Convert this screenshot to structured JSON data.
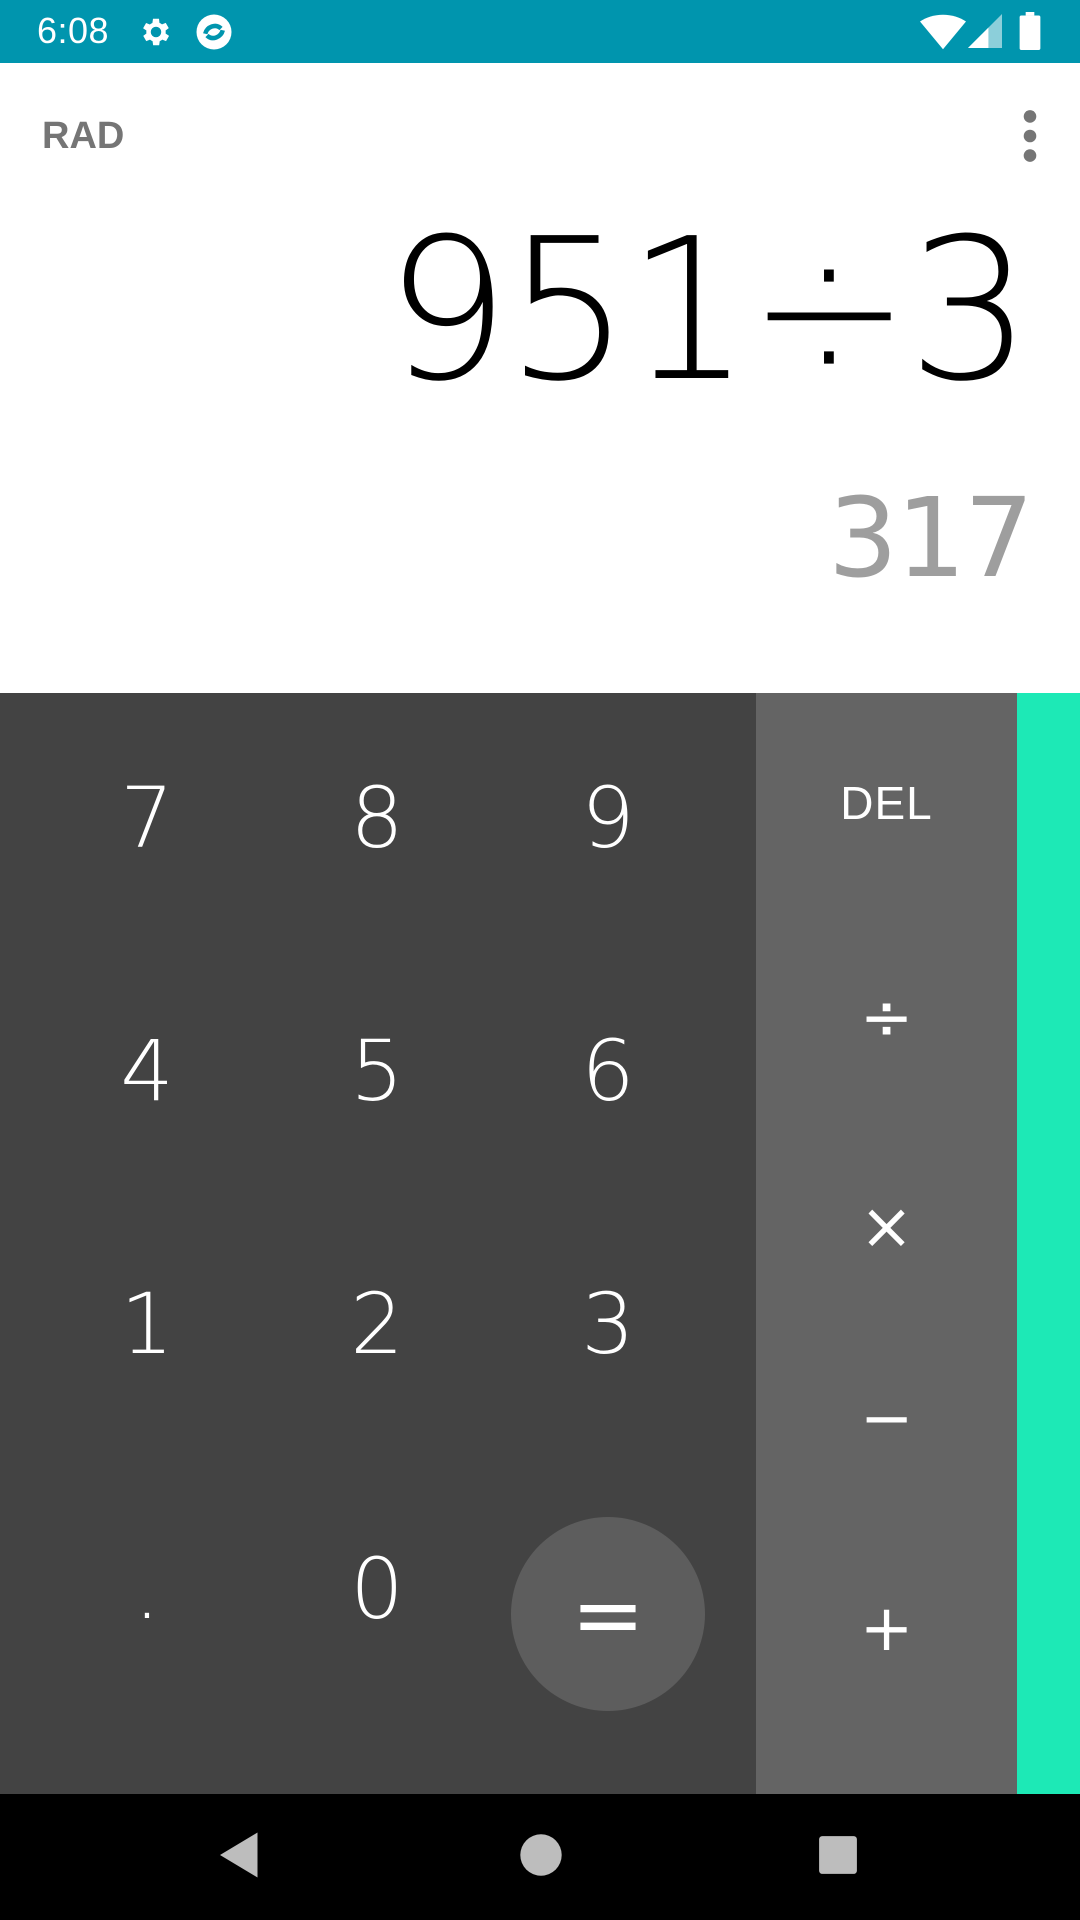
{
  "status_bar": {
    "time": "6:08",
    "icons": [
      "gear-icon",
      "app-notification-icon",
      "wifi-icon",
      "cell-signal-icon",
      "battery-icon"
    ]
  },
  "display": {
    "mode": "RAD",
    "formula": "951÷3",
    "result": "317"
  },
  "keypad": {
    "digits": [
      "7",
      "8",
      "9",
      "4",
      "5",
      "6",
      "1",
      "2",
      "3",
      ".",
      "0"
    ],
    "equals": "="
  },
  "operators": {
    "del": "DEL",
    "divide": "÷",
    "multiply": "×",
    "minus": "−",
    "plus": "+"
  },
  "colors": {
    "status_bar": "#0095ae",
    "keypad_bg": "#434343",
    "operator_bg": "#646464",
    "advanced_accent": "#1de9b6"
  },
  "nav": {
    "icons": [
      "back-icon",
      "home-icon",
      "recents-icon"
    ]
  }
}
